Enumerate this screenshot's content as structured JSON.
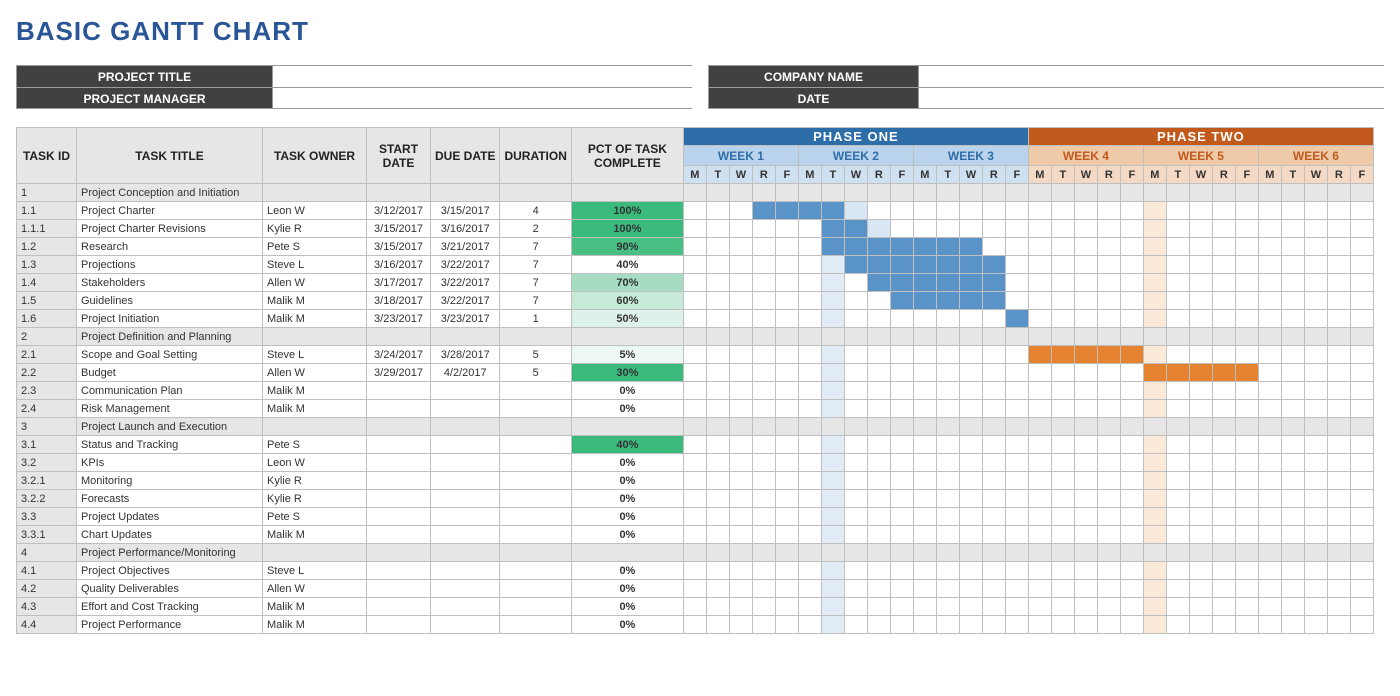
{
  "title": "BASIC GANTT CHART",
  "info": {
    "project_title_label": "PROJECT TITLE",
    "project_title_value": "",
    "project_manager_label": "PROJECT MANAGER",
    "project_manager_value": "",
    "company_name_label": "COMPANY NAME",
    "company_name_value": "",
    "date_label": "DATE",
    "date_value": ""
  },
  "columns": {
    "task_id": "TASK ID",
    "task_title": "TASK TITLE",
    "task_owner": "TASK OWNER",
    "start_date": "START DATE",
    "due_date": "DUE DATE",
    "duration": "DURATION",
    "pct": "PCT OF TASK COMPLETE"
  },
  "phases": [
    {
      "name": "PHASE ONE",
      "color": "#2e6ea8",
      "weekbg": "#cfe0f1",
      "weekhdr": "#b9d3ec",
      "daybg": "#eaf1f9",
      "darkbar": "#5a93c8",
      "lightbar": "#d9e6f3",
      "weeks": [
        "WEEK 1",
        "WEEK 2",
        "WEEK 3"
      ]
    },
    {
      "name": "PHASE TWO",
      "color": "#c25a1d",
      "weekbg": "#f4d9c4",
      "weekhdr": "#eecaa9",
      "daybg": "#fcefe4",
      "darkbar": "#e58331",
      "lightbar": "#f9e3d1",
      "weeks": [
        "WEEK 4",
        "WEEK 5",
        "WEEK 6"
      ]
    }
  ],
  "days": [
    "M",
    "T",
    "W",
    "R",
    "F"
  ],
  "rows": [
    {
      "id": "1",
      "title": "Project Conception and Initiation",
      "section": true
    },
    {
      "id": "1.1",
      "title": "Project Charter",
      "owner": "Leon W",
      "start": "3/12/2017",
      "due": "3/15/2017",
      "dur": "4",
      "pct": "100%",
      "pct_fill": "#3bba7d",
      "bar": [
        3,
        4,
        5,
        6
      ],
      "light": [
        3,
        4,
        5,
        6,
        7
      ]
    },
    {
      "id": "1.1.1",
      "title": "Project Charter Revisions",
      "owner": "Kylie R",
      "start": "3/15/2017",
      "due": "3/16/2017",
      "dur": "2",
      "pct": "100%",
      "pct_fill": "#3bba7d",
      "bar": [
        6,
        7
      ],
      "light": [
        6,
        7,
        8
      ]
    },
    {
      "id": "1.2",
      "title": "Research",
      "owner": "Pete S",
      "start": "3/15/2017",
      "due": "3/21/2017",
      "dur": "7",
      "pct": "90%",
      "pct_fill": "#49bf84",
      "bar": [
        6,
        7,
        8,
        9,
        10,
        11,
        12
      ],
      "light": [
        6,
        7,
        8,
        9,
        10,
        11,
        12
      ]
    },
    {
      "id": "1.3",
      "title": "Projections",
      "owner": "Steve L",
      "start": "3/16/2017",
      "due": "3/22/2017",
      "dur": "7",
      "pct": "40%",
      "pct_fill": "",
      "bar": [
        7,
        8,
        9,
        10,
        11,
        12,
        13
      ],
      "light": [
        7,
        8,
        9,
        10,
        11,
        12,
        13
      ]
    },
    {
      "id": "1.4",
      "title": "Stakeholders",
      "owner": "Allen W",
      "start": "3/17/2017",
      "due": "3/22/2017",
      "dur": "7",
      "pct": "70%",
      "pct_fill": "#a6dcc2",
      "bar": [
        8,
        9,
        10,
        11,
        12,
        13
      ],
      "light": [
        8,
        9,
        10,
        11,
        12,
        13
      ]
    },
    {
      "id": "1.5",
      "title": "Guidelines",
      "owner": "Malik M",
      "start": "3/18/2017",
      "due": "3/22/2017",
      "dur": "7",
      "pct": "60%",
      "pct_fill": "#c7e9d8",
      "bar": [
        9,
        10,
        11,
        12,
        13
      ],
      "light": [
        9,
        10,
        11,
        12,
        13
      ]
    },
    {
      "id": "1.6",
      "title": "Project Initiation",
      "owner": "Malik M",
      "start": "3/23/2017",
      "due": "3/23/2017",
      "dur": "1",
      "pct": "50%",
      "pct_fill": "#dff2e9",
      "bar": [
        14
      ],
      "light": [
        14
      ]
    },
    {
      "id": "2",
      "title": "Project Definition and Planning",
      "section": true
    },
    {
      "id": "2.1",
      "title": "Scope and Goal Setting",
      "owner": "Steve L",
      "start": "3/24/2017",
      "due": "3/28/2017",
      "dur": "5",
      "pct": "5%",
      "pct_fill": "#eef8f3",
      "bar": [
        15,
        16,
        17,
        18,
        19
      ],
      "light": [
        15,
        16,
        17,
        18,
        19
      ]
    },
    {
      "id": "2.2",
      "title": "Budget",
      "owner": "Allen W",
      "start": "3/29/2017",
      "due": "4/2/2017",
      "dur": "5",
      "pct": "30%",
      "pct_fill": "#3bba7d",
      "bar": [
        20,
        21,
        22,
        23,
        24
      ],
      "light": [
        20,
        21,
        22,
        23,
        24
      ]
    },
    {
      "id": "2.3",
      "title": "Communication Plan",
      "owner": "Malik M",
      "start": "",
      "due": "",
      "dur": "",
      "pct": "0%",
      "pct_fill": ""
    },
    {
      "id": "2.4",
      "title": "Risk Management",
      "owner": "Malik M",
      "start": "",
      "due": "",
      "dur": "",
      "pct": "0%",
      "pct_fill": ""
    },
    {
      "id": "3",
      "title": "Project Launch and Execution",
      "section": true
    },
    {
      "id": "3.1",
      "title": "Status and Tracking",
      "owner": "Pete S",
      "start": "",
      "due": "",
      "dur": "",
      "pct": "40%",
      "pct_fill": "#3bba7d"
    },
    {
      "id": "3.2",
      "title": "KPIs",
      "owner": "Leon W",
      "start": "",
      "due": "",
      "dur": "",
      "pct": "0%",
      "pct_fill": ""
    },
    {
      "id": "3.2.1",
      "title": "Monitoring",
      "owner": "Kylie R",
      "start": "",
      "due": "",
      "dur": "",
      "pct": "0%",
      "pct_fill": ""
    },
    {
      "id": "3.2.2",
      "title": "Forecasts",
      "owner": "Kylie R",
      "start": "",
      "due": "",
      "dur": "",
      "pct": "0%",
      "pct_fill": ""
    },
    {
      "id": "3.3",
      "title": "Project Updates",
      "owner": "Pete S",
      "start": "",
      "due": "",
      "dur": "",
      "pct": "0%",
      "pct_fill": ""
    },
    {
      "id": "3.3.1",
      "title": "Chart Updates",
      "owner": "Malik M",
      "start": "",
      "due": "",
      "dur": "",
      "pct": "0%",
      "pct_fill": ""
    },
    {
      "id": "4",
      "title": "Project Performance/Monitoring",
      "section": true
    },
    {
      "id": "4.1",
      "title": "Project Objectives",
      "owner": "Steve L",
      "start": "",
      "due": "",
      "dur": "",
      "pct": "0%",
      "pct_fill": ""
    },
    {
      "id": "4.2",
      "title": "Quality Deliverables",
      "owner": "Allen W",
      "start": "",
      "due": "",
      "dur": "",
      "pct": "0%",
      "pct_fill": ""
    },
    {
      "id": "4.3",
      "title": "Effort and Cost Tracking",
      "owner": "Malik M",
      "start": "",
      "due": "",
      "dur": "",
      "pct": "0%",
      "pct_fill": ""
    },
    {
      "id": "4.4",
      "title": "Project Performance",
      "owner": "Malik M",
      "start": "",
      "due": "",
      "dur": "",
      "pct": "0%",
      "pct_fill": ""
    }
  ],
  "calendar": {
    "shade_phase1_col": 6,
    "shade_phase2_col": 20
  },
  "chart_data": {
    "type": "gantt",
    "title": "BASIC GANTT CHART",
    "phases": [
      "PHASE ONE",
      "PHASE TWO"
    ],
    "weeks": [
      "WEEK 1",
      "WEEK 2",
      "WEEK 3",
      "WEEK 4",
      "WEEK 5",
      "WEEK 6"
    ],
    "day_labels": [
      "M",
      "T",
      "W",
      "R",
      "F"
    ],
    "tasks": [
      {
        "id": "1",
        "title": "Project Conception and Initiation",
        "group": true
      },
      {
        "id": "1.1",
        "title": "Project Charter",
        "owner": "Leon W",
        "start": "2017-03-12",
        "due": "2017-03-15",
        "duration": 4,
        "pct_complete": 100
      },
      {
        "id": "1.1.1",
        "title": "Project Charter Revisions",
        "owner": "Kylie R",
        "start": "2017-03-15",
        "due": "2017-03-16",
        "duration": 2,
        "pct_complete": 100
      },
      {
        "id": "1.2",
        "title": "Research",
        "owner": "Pete S",
        "start": "2017-03-15",
        "due": "2017-03-21",
        "duration": 7,
        "pct_complete": 90
      },
      {
        "id": "1.3",
        "title": "Projections",
        "owner": "Steve L",
        "start": "2017-03-16",
        "due": "2017-03-22",
        "duration": 7,
        "pct_complete": 40
      },
      {
        "id": "1.4",
        "title": "Stakeholders",
        "owner": "Allen W",
        "start": "2017-03-17",
        "due": "2017-03-22",
        "duration": 7,
        "pct_complete": 70
      },
      {
        "id": "1.5",
        "title": "Guidelines",
        "owner": "Malik M",
        "start": "2017-03-18",
        "due": "2017-03-22",
        "duration": 7,
        "pct_complete": 60
      },
      {
        "id": "1.6",
        "title": "Project Initiation",
        "owner": "Malik M",
        "start": "2017-03-23",
        "due": "2017-03-23",
        "duration": 1,
        "pct_complete": 50
      },
      {
        "id": "2",
        "title": "Project Definition and Planning",
        "group": true
      },
      {
        "id": "2.1",
        "title": "Scope and Goal Setting",
        "owner": "Steve L",
        "start": "2017-03-24",
        "due": "2017-03-28",
        "duration": 5,
        "pct_complete": 5
      },
      {
        "id": "2.2",
        "title": "Budget",
        "owner": "Allen W",
        "start": "2017-03-29",
        "due": "2017-04-02",
        "duration": 5,
        "pct_complete": 30
      },
      {
        "id": "2.3",
        "title": "Communication Plan",
        "owner": "Malik M",
        "pct_complete": 0
      },
      {
        "id": "2.4",
        "title": "Risk Management",
        "owner": "Malik M",
        "pct_complete": 0
      },
      {
        "id": "3",
        "title": "Project Launch and Execution",
        "group": true
      },
      {
        "id": "3.1",
        "title": "Status and Tracking",
        "owner": "Pete S",
        "pct_complete": 40
      },
      {
        "id": "3.2",
        "title": "KPIs",
        "owner": "Leon W",
        "pct_complete": 0
      },
      {
        "id": "3.2.1",
        "title": "Monitoring",
        "owner": "Kylie R",
        "pct_complete": 0
      },
      {
        "id": "3.2.2",
        "title": "Forecasts",
        "owner": "Kylie R",
        "pct_complete": 0
      },
      {
        "id": "3.3",
        "title": "Project Updates",
        "owner": "Pete S",
        "pct_complete": 0
      },
      {
        "id": "3.3.1",
        "title": "Chart Updates",
        "owner": "Malik M",
        "pct_complete": 0
      },
      {
        "id": "4",
        "title": "Project Performance/Monitoring",
        "group": true
      },
      {
        "id": "4.1",
        "title": "Project Objectives",
        "owner": "Steve L",
        "pct_complete": 0
      },
      {
        "id": "4.2",
        "title": "Quality Deliverables",
        "owner": "Allen W",
        "pct_complete": 0
      },
      {
        "id": "4.3",
        "title": "Effort and Cost Tracking",
        "owner": "Malik M",
        "pct_complete": 0
      },
      {
        "id": "4.4",
        "title": "Project Performance",
        "owner": "Malik M",
        "pct_complete": 0
      }
    ]
  }
}
